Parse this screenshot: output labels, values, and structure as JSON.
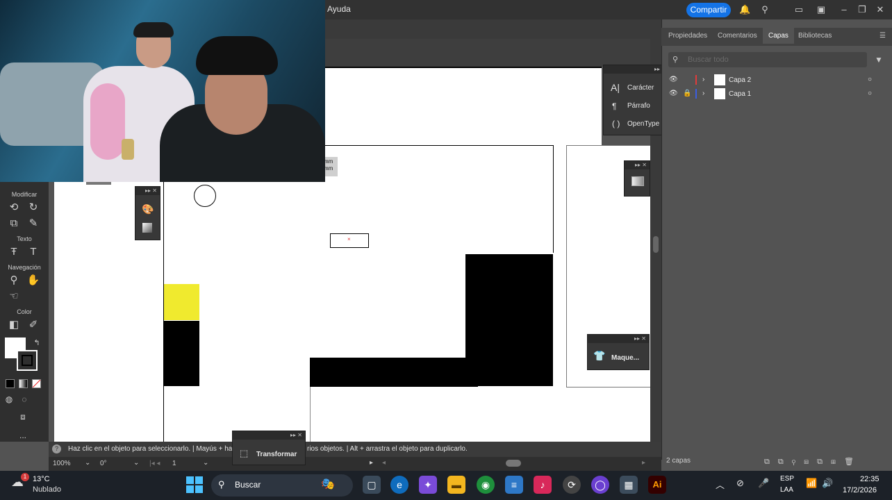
{
  "menubar": {
    "menu_ayuda": "Ayuda",
    "share_label": "Compartir"
  },
  "floating_panels": {
    "type_panel": {
      "items": [
        "Carácter",
        "Párrafo",
        "OpenType"
      ]
    },
    "maqueta_panel": {
      "label": "Maque..."
    },
    "transform_panel": {
      "label": "Transformar"
    }
  },
  "ruler_units": {
    "line1": "mm",
    "line2": "mm"
  },
  "toolbar": {
    "sections": [
      "Modificar",
      "Texto",
      "Navegación",
      "Color"
    ],
    "more": "..."
  },
  "right_panel": {
    "tabs": [
      "Propiedades",
      "Comentarios",
      "Capas",
      "Bibliotecas"
    ],
    "active_tab": "Capas",
    "search_placeholder": "Buscar todo",
    "layers": [
      {
        "name": "Capa 2",
        "color": "#e23b3b",
        "locked": false
      },
      {
        "name": "Capa 1",
        "color": "#3b5ee2",
        "locked": true
      }
    ],
    "layers_count": "2 capas"
  },
  "status": {
    "hint": "Haz clic en el objeto para seleccionarlo.  |  Mayús + ha",
    "hint2": "rios objetos.  |  Alt + arrastra el objeto para duplicarlo."
  },
  "zoom": {
    "zoom_value": "100%",
    "rotation": "0°",
    "artboard_num": "1"
  },
  "taskbar": {
    "weather_temp": "13°C",
    "weather_desc": "Nublado",
    "weather_badge": "1",
    "search_label": "Buscar",
    "lang_line1": "ESP",
    "lang_line2": "LAA",
    "time": "22:35",
    "date": "17/2/2026"
  },
  "colors": {
    "accent": "#1473e6",
    "yellow_shape": "#f0ea2e"
  }
}
